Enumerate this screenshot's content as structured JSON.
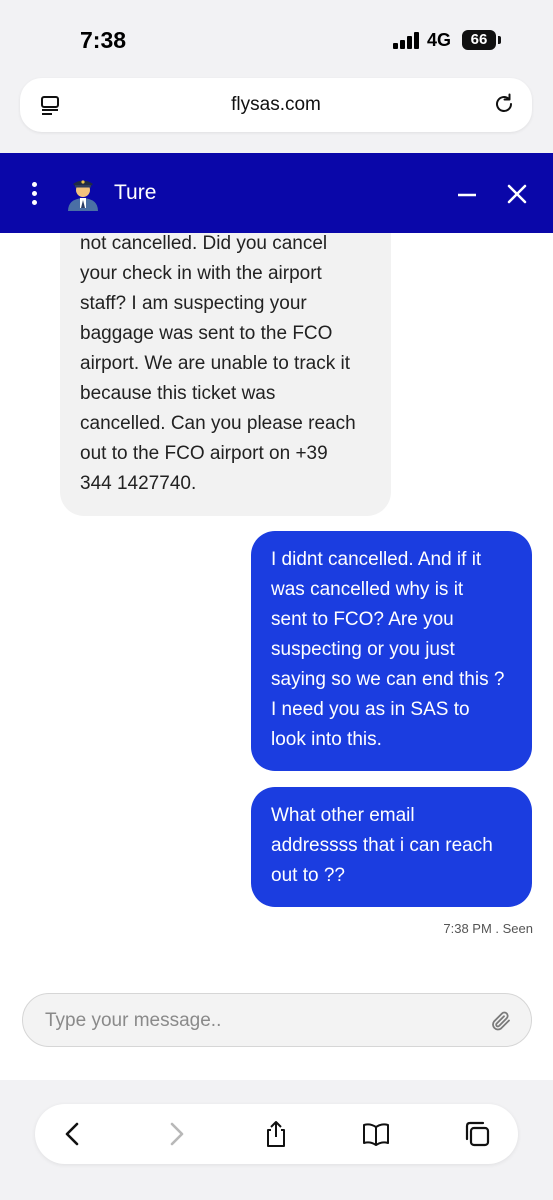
{
  "status_bar": {
    "time": "7:38",
    "network": "4G",
    "battery": "66"
  },
  "browser": {
    "url": "flysas.com",
    "icons": [
      "tab-overview-icon",
      "reload-icon"
    ]
  },
  "chat_header": {
    "title": "Ture",
    "background_color": "#0a07a9",
    "icons": [
      "more-vertical-icon",
      "pilot-avatar-icon",
      "minimize-icon",
      "close-icon"
    ]
  },
  "messages": [
    {
      "sender": "agent",
      "text": "not cancelled. Did you cancel\nyour check in with the airport\nstaff? I am suspecting your\nbaggage was sent to the FCO\nairport. We are unable to track it\nbecause this ticket was\ncancelled. Can you please reach\nout to the FCO airport on +39\n344 1427740."
    },
    {
      "sender": "user",
      "text": "I didnt cancelled. And if it\nwas cancelled why is it\nsent to FCO? Are you\nsuspecting or you just\nsaying so we can end this ?\nI need you as in SAS to\nlook into this."
    },
    {
      "sender": "user",
      "text": "What other email\naddressss that i can reach\nout to ??"
    }
  ],
  "message_meta": "7:38 PM . Seen",
  "composer": {
    "placeholder": "Type your message..",
    "value": ""
  },
  "toolbar": {
    "buttons": [
      "back-icon",
      "forward-icon",
      "share-icon",
      "bookmarks-icon",
      "tabs-icon"
    ]
  },
  "colors": {
    "user_bubble": "#1b3de0",
    "agent_bubble": "#f2f2f2"
  }
}
